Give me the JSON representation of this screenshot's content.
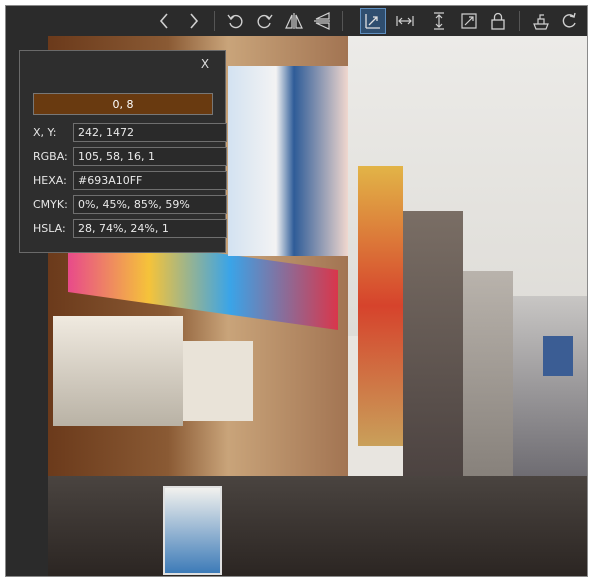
{
  "toolbar": {
    "icons": [
      "chevron-left-icon",
      "chevron-right-icon",
      "rotate-left-icon",
      "rotate-right-icon",
      "flip-horizontal-icon",
      "flip-vertical-icon",
      "fit-icon",
      "fit-width-icon",
      "fit-height-icon",
      "expand-icon",
      "lock-icon",
      "crop-icon",
      "refresh-icon"
    ],
    "active_icon": "fit-icon"
  },
  "color_panel": {
    "close_label": "X",
    "swatch_label": "0, 8",
    "swatch_color": "#693A10",
    "rows": [
      {
        "label": "X, Y:",
        "value": "242, 1472"
      },
      {
        "label": "RGBA:",
        "value": "105, 58, 16, 1"
      },
      {
        "label": "HEXA:",
        "value": "#693A10FF"
      },
      {
        "label": "CMYK:",
        "value": "0%, 45%, 85%, 59%"
      },
      {
        "label": "HSLA:",
        "value": "28, 74%, 24%, 1"
      }
    ]
  }
}
